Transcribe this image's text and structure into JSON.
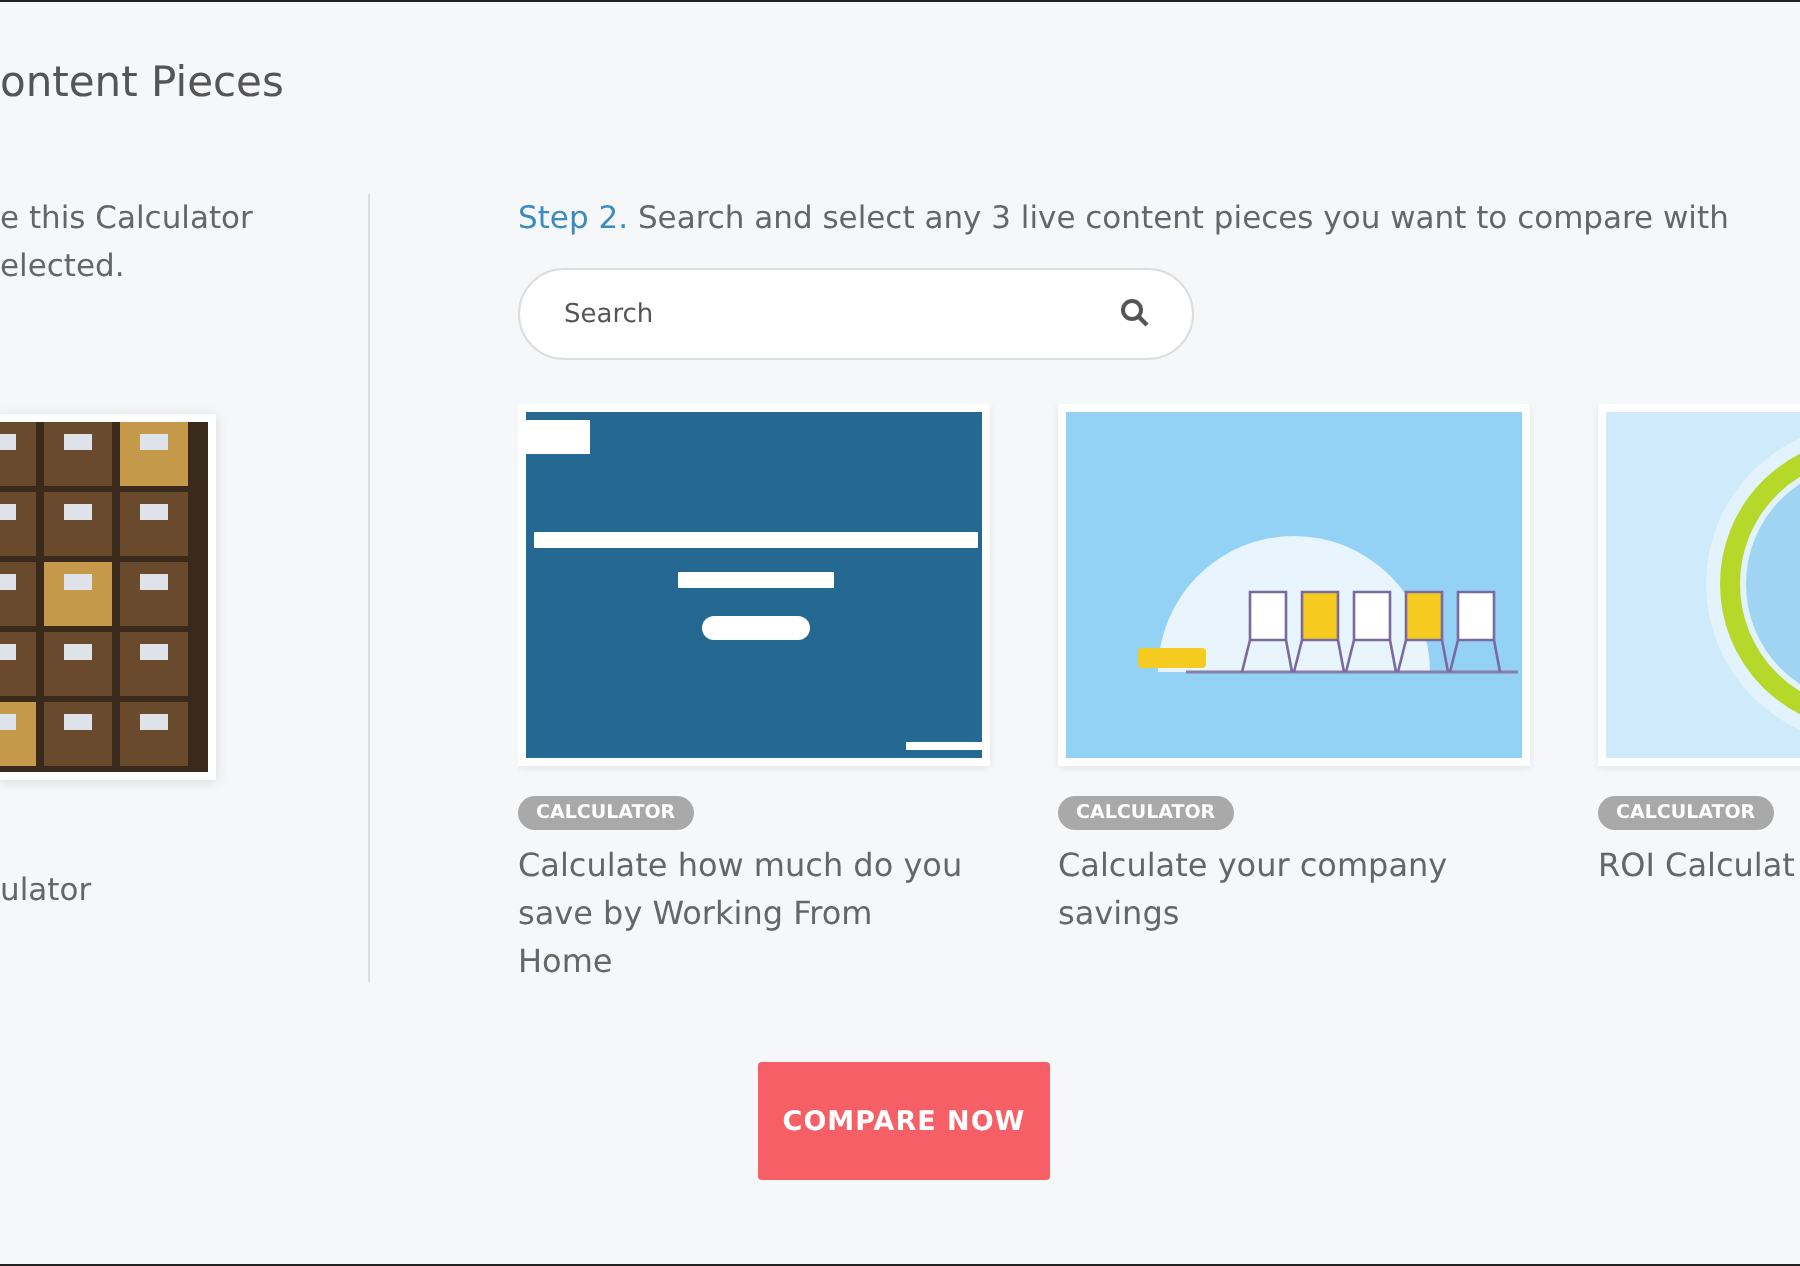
{
  "title": "ontent Pieces",
  "step1": {
    "lines": [
      "e this Calculator",
      "elected."
    ],
    "card": {
      "kind": "picture",
      "title": "ulator"
    }
  },
  "step2": {
    "label": "Step 2.",
    "text": "Search and select any 3 live content pieces you want to compare with"
  },
  "search": {
    "placeholder": "Search"
  },
  "cards": [
    {
      "tag": "CALCULATOR",
      "title": "Calculate how much do you save by Working From Home",
      "kind": "form"
    },
    {
      "tag": "CALCULATOR",
      "title": "Calculate your company savings",
      "kind": "chairs"
    },
    {
      "tag": "CALCULATOR",
      "title": "ROI Calculat",
      "kind": "ring"
    }
  ],
  "button": "COMPARE NOW"
}
